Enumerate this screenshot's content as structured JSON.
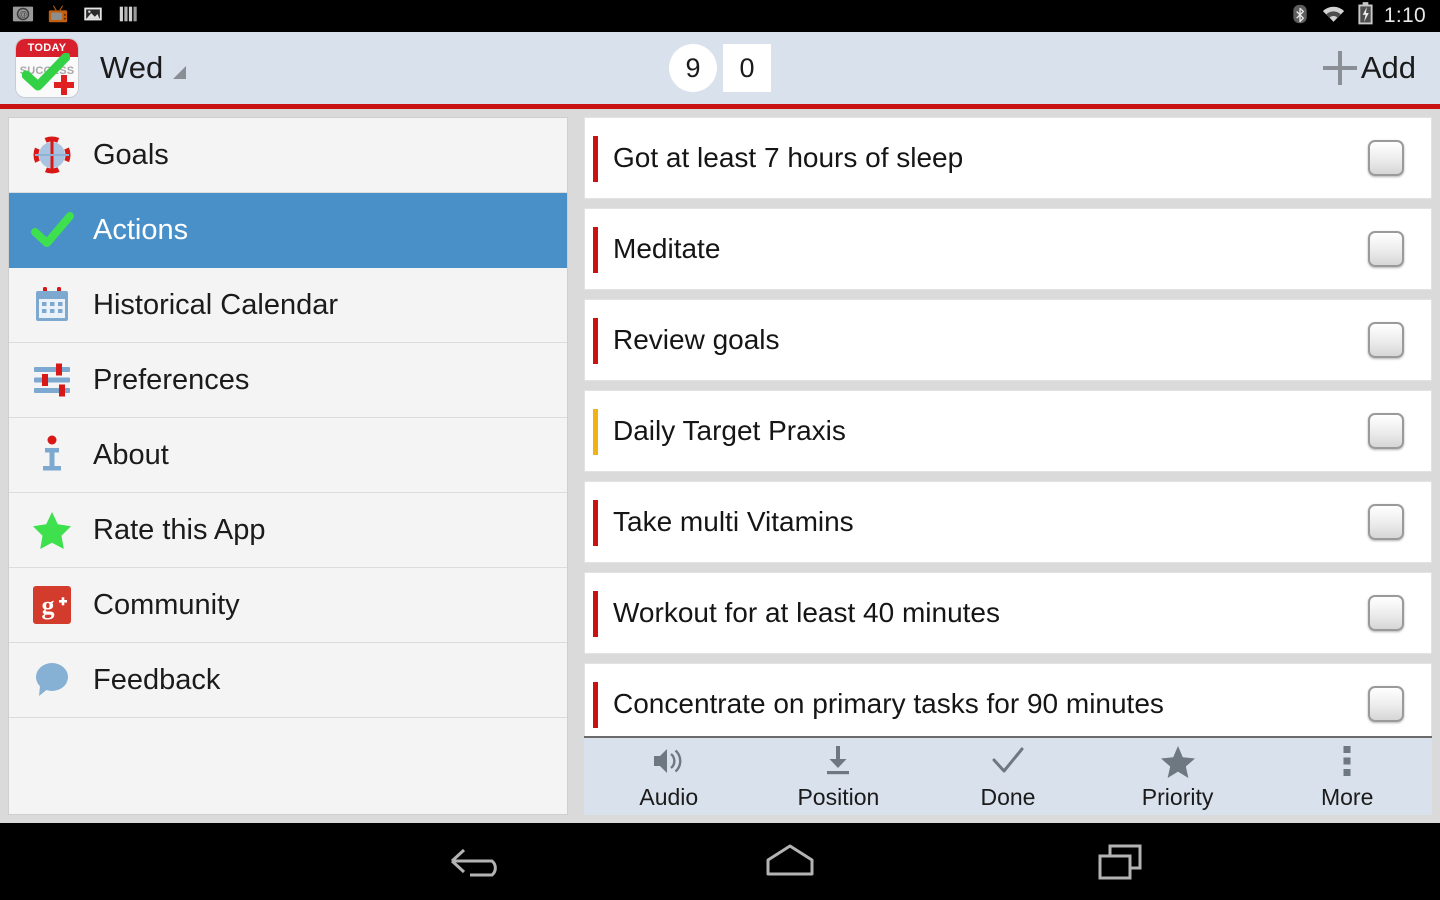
{
  "statusbar": {
    "time": "1:10",
    "left_icons": [
      "email-icon",
      "tv-icon",
      "photo-icon",
      "bars-icon"
    ],
    "right_icons": [
      "bluetooth-icon",
      "wifi-icon",
      "battery-charging-icon"
    ]
  },
  "actionbar": {
    "app_logo": {
      "top_text": "TODAY",
      "word_text": "SUCCESS"
    },
    "day_label": "Wed",
    "counter_circle": "9",
    "counter_square": "0",
    "add_label": "Add",
    "accent_color": "#c91212",
    "background_color": "#d8e1ec"
  },
  "sidebar": {
    "items": [
      {
        "label": "Goals",
        "icon": "target-icon",
        "active": false
      },
      {
        "label": "Actions",
        "icon": "check-icon",
        "active": true
      },
      {
        "label": "Historical Calendar",
        "icon": "calendar-icon",
        "active": false
      },
      {
        "label": "Preferences",
        "icon": "sliders-icon",
        "active": false
      },
      {
        "label": "About",
        "icon": "info-icon",
        "active": false
      },
      {
        "label": "Rate this App",
        "icon": "star-icon",
        "active": false
      },
      {
        "label": "Community",
        "icon": "google-plus-icon",
        "active": false
      },
      {
        "label": "Feedback",
        "icon": "speech-bubble-icon",
        "active": false
      }
    ],
    "selected_color": "#4a90c8"
  },
  "tasks": [
    {
      "text": "Got at least 7 hours of sleep",
      "priority_color": "#cc1111",
      "checked": false
    },
    {
      "text": "Meditate",
      "priority_color": "#cc1111",
      "checked": false
    },
    {
      "text": "Review goals",
      "priority_color": "#cc1111",
      "checked": false
    },
    {
      "text": "Daily Target Praxis",
      "priority_color": "#f2b212",
      "checked": false
    },
    {
      "text": "Take multi Vitamins",
      "priority_color": "#cc1111",
      "checked": false
    },
    {
      "text": "Workout for at least 40  minutes",
      "priority_color": "#cc1111",
      "checked": false
    },
    {
      "text": "Concentrate on primary tasks for 90 minutes",
      "priority_color": "#cc1111",
      "checked": false
    }
  ],
  "context_toolbar": [
    {
      "label": "Audio",
      "icon": "speaker-icon"
    },
    {
      "label": "Position",
      "icon": "arrow-down-to-line-icon"
    },
    {
      "label": "Done",
      "icon": "checkmark-icon"
    },
    {
      "label": "Priority",
      "icon": "star-icon"
    },
    {
      "label": "More",
      "icon": "overflow-dots-icon"
    }
  ],
  "navbar": {
    "back": "back-icon",
    "home": "home-icon",
    "recents": "recents-icon"
  }
}
